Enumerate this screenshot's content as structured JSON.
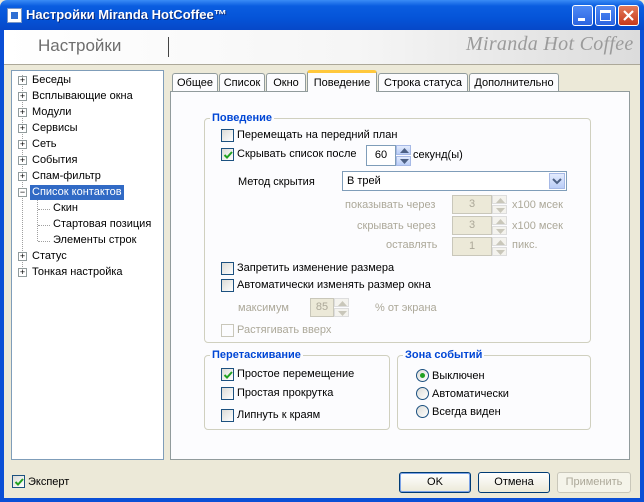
{
  "window": {
    "title": "Настройки Miranda HotCoffee™",
    "header_title": "Настройки",
    "brand": "Miranda Hot Coffee"
  },
  "tree": {
    "items": [
      {
        "label": "Беседы"
      },
      {
        "label": "Всплывающие окна"
      },
      {
        "label": "Модули"
      },
      {
        "label": "Сервисы"
      },
      {
        "label": "Сеть"
      },
      {
        "label": "События"
      },
      {
        "label": "Спам-фильтр"
      },
      {
        "label": "Список контактов",
        "selected": true
      },
      {
        "label": "Скин"
      },
      {
        "label": "Стартовая позиция"
      },
      {
        "label": "Элементы строк"
      },
      {
        "label": "Статус"
      },
      {
        "label": "Тонкая настройка"
      }
    ]
  },
  "tabs": [
    {
      "label": "Общее"
    },
    {
      "label": "Список"
    },
    {
      "label": "Окно"
    },
    {
      "label": "Поведение",
      "active": true
    },
    {
      "label": "Строка статуса"
    },
    {
      "label": "Дополнительно"
    }
  ],
  "behavior": {
    "group_label": "Поведение",
    "bring_front": {
      "label": "Перемещать на передний план",
      "checked": false
    },
    "hide_list": {
      "label": "Скрывать список после",
      "checked": true,
      "value": "60",
      "unit": "секунд(ы)"
    },
    "hide_method": {
      "label": "Метод скрытия",
      "value": "В трей"
    },
    "show_after": {
      "label": "показывать через",
      "value": "3",
      "unit": "x100 мсек"
    },
    "hide_after": {
      "label": "скрывать через",
      "value": "3",
      "unit": "x100 мсек"
    },
    "leave": {
      "label": "оставлять",
      "value": "1",
      "unit": "пикс."
    },
    "no_resize": {
      "label": "Запретить изменение размера",
      "checked": false
    },
    "auto_resize": {
      "label": "Автоматически изменять размер окна",
      "checked": false
    },
    "max": {
      "label": "максимум",
      "value": "85",
      "unit": "% от экрана"
    },
    "stretch_up": {
      "label": "Растягивать вверх",
      "checked": false
    }
  },
  "dragging": {
    "group_label": "Перетаскивание",
    "simple_move": {
      "label": "Простое перемещение",
      "checked": true
    },
    "simple_scroll": {
      "label": "Простая прокрутка",
      "checked": false
    },
    "snap_edges": {
      "label": "Липнуть к краям",
      "checked": false
    }
  },
  "events_area": {
    "group_label": "Зона событий",
    "options": [
      {
        "label": "Выключен",
        "selected": true
      },
      {
        "label": "Автоматически",
        "selected": false
      },
      {
        "label": "Всегда виден",
        "selected": false
      }
    ]
  },
  "footer": {
    "expert": {
      "label": "Эксперт",
      "checked": true
    },
    "ok": "OK",
    "cancel": "Отмена",
    "apply": "Применить"
  }
}
